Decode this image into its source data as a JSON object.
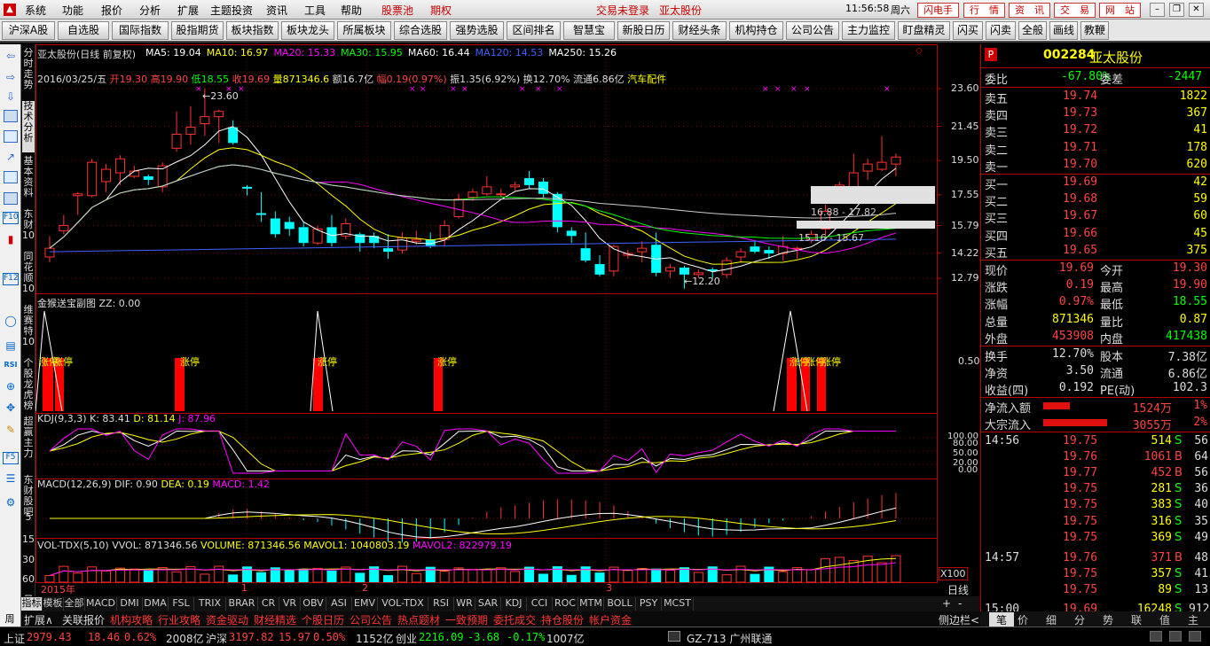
{
  "menu": {
    "items": [
      "系统",
      "功能",
      "报价",
      "分析",
      "扩展",
      "主题投资",
      "资讯",
      "工具",
      "帮助",
      "股票池",
      "期权"
    ],
    "login_status": "交易未登录",
    "stock_name": "亚太股份",
    "clock": "11:56:58",
    "weekday": "周六",
    "right_buttons": [
      "闪电手",
      "行　情",
      "资　讯",
      "交　易",
      "网　站"
    ]
  },
  "toolbar": {
    "buttons": [
      "沪深A股",
      "自选股",
      "国际指数",
      "股指期货",
      "板块指数",
      "板块龙头",
      "所属板块",
      "综合选股",
      "强势选股",
      "区间排名",
      "智慧宝",
      "新股日历",
      "财经头条",
      "机构持仓",
      "公司公告",
      "主力监控",
      "盯盘精灵",
      "闪买",
      "闪卖",
      "全般",
      "画线",
      "教鞭"
    ]
  },
  "left_tabs": [
    {
      "label": "分时走势"
    },
    {
      "label": "技术分析",
      "active": true
    },
    {
      "label": "基本资料"
    },
    {
      "label": "东财10"
    },
    {
      "label": "同花顺10"
    },
    {
      "label": "维赛特10"
    },
    {
      "label": "个股龙虎榜"
    },
    {
      "label": "超赢主力"
    },
    {
      "label": "东财股吧"
    },
    {
      "label": "5"
    },
    {
      "label": "15"
    },
    {
      "label": "30"
    },
    {
      "label": "60"
    },
    {
      "label": "日"
    },
    {
      "label": "周"
    }
  ],
  "main": {
    "title": "亚太股份(日线 前复权)",
    "ma": [
      {
        "label": "MA5: 19.04",
        "color": "#ffffff"
      },
      {
        "label": "MA10: 16.97",
        "color": "#ffff00"
      },
      {
        "label": "MA20: 15.33",
        "color": "#ff00ff"
      },
      {
        "label": "MA30: 15.95",
        "color": "#00ff00"
      },
      {
        "label": "MA60: 16.44",
        "color": "#ffffff"
      },
      {
        "label": "MA120: 14.53",
        "color": "#4060ff"
      },
      {
        "label": "MA250: 15.26",
        "color": "#ffffff"
      }
    ],
    "info": {
      "date": "2016/03/25/五",
      "open": "开19.30",
      "high": "高19.90",
      "low": "低18.55",
      "close": "收19.69",
      "vol": "量871346.6",
      "amount": "额16.7亿",
      "change": "幅0.19(0.97%)",
      "amp": "振1.35(6.92%)",
      "turnover": "换12.70%",
      "float": "流通6.86亿",
      "sector": "汽车配件"
    },
    "yaxis": [
      "23.60",
      "21.45",
      "19.50",
      "17.55",
      "15.79",
      "14.22",
      "12.79"
    ],
    "hi_label": "23.60",
    "lo_label": "12.20",
    "range_upper": "16.88 - 17.82",
    "range_lower": "15.16 - 15.67"
  },
  "sub1": {
    "title": "金猴送宝副图",
    "zz": "ZZ: 0.00",
    "tag": "涨停",
    "yaxis": "0.50"
  },
  "kdj": {
    "title": "KDJ(9,3,3)",
    "k": "K: 83.41",
    "d": "D: 81.14",
    "j": "J: 87.96",
    "yaxis": [
      "100.00",
      "80.00",
      "50.00",
      "20.00",
      "0.00"
    ]
  },
  "macd": {
    "title": "MACD(12,26,9)",
    "dif": "DIF: 0.90",
    "dea": "DEA: 0.19",
    "macd": "MACD: 1.42"
  },
  "vol": {
    "title": "VOL-TDX(5,10)",
    "vvol": "VVOL: 871346.56",
    "volume": "VOLUME: 871346.56",
    "mavol1": "MAVOL1: 1040803.19",
    "mavol2": "MAVOL2: 822979.19",
    "unit": "X100"
  },
  "timeaxis": {
    "labels": [
      "2015年",
      "1",
      "2",
      "3"
    ],
    "period": "日线"
  },
  "bottom_tabs": [
    "指标",
    "模板",
    "全部",
    "MACD",
    "DMI",
    "DMA",
    "FSL",
    "TRIX",
    "BRAR",
    "CR",
    "VR",
    "OBV",
    "ASI",
    "EMV",
    "VOL-TDX",
    "RSI",
    "WR",
    "SAR",
    "KDJ",
    "CCI",
    "ROC",
    "MTM",
    "BOLL",
    "PSY",
    "MCST"
  ],
  "extra_tabs": [
    "扩展∧",
    "关联报价",
    "机构攻略",
    "行业攻略",
    "资金驱动",
    "财经精选",
    "个股日历",
    "公司公告",
    "热点题材",
    "一致预期",
    "委托成交",
    "持仓股份",
    "帐户资金"
  ],
  "quote": {
    "code": "002284",
    "name": "亚太股份",
    "weibi": {
      "label": "委比",
      "value": "-67.80%",
      "label2": "委差",
      "value2": "-2447"
    },
    "asks": [
      {
        "label": "卖五",
        "price": "19.74",
        "vol": "1822"
      },
      {
        "label": "卖四",
        "price": "19.73",
        "vol": "367"
      },
      {
        "label": "卖三",
        "price": "19.72",
        "vol": "41"
      },
      {
        "label": "卖二",
        "price": "19.71",
        "vol": "178"
      },
      {
        "label": "卖一",
        "price": "19.70",
        "vol": "620"
      }
    ],
    "bids": [
      {
        "label": "买一",
        "price": "19.69",
        "vol": "42"
      },
      {
        "label": "买二",
        "price": "19.68",
        "vol": "59"
      },
      {
        "label": "买三",
        "price": "19.67",
        "vol": "60"
      },
      {
        "label": "买四",
        "price": "19.66",
        "vol": "45"
      },
      {
        "label": "买五",
        "price": "19.65",
        "vol": "375"
      }
    ],
    "stats": [
      {
        "l1": "现价",
        "v1": "19.69",
        "c1": "#ff4444",
        "l2": "今开",
        "v2": "19.30",
        "c2": "#ff4444"
      },
      {
        "l1": "涨跌",
        "v1": "0.19",
        "c1": "#ff4444",
        "l2": "最高",
        "v2": "19.90",
        "c2": "#ff4444"
      },
      {
        "l1": "涨幅",
        "v1": "0.97%",
        "c1": "#ff4444",
        "l2": "最低",
        "v2": "18.55",
        "c2": "#00ff00"
      },
      {
        "l1": "总量",
        "v1": "871346",
        "c1": "#ffff00",
        "l2": "量比",
        "v2": "0.87",
        "c2": "#ffff00"
      },
      {
        "l1": "外盘",
        "v1": "453908",
        "c1": "#ff4444",
        "l2": "内盘",
        "v2": "417438",
        "c2": "#00ff00"
      }
    ],
    "stats2": [
      {
        "l1": "换手",
        "v1": "12.70%",
        "l2": "股本",
        "v2": "7.38亿"
      },
      {
        "l1": "净资",
        "v1": "3.50",
        "l2": "流通",
        "v2": "6.86亿"
      },
      {
        "l1": "收益(四)",
        "v1": "0.192",
        "l2": "PE(动)",
        "v2": "102.3"
      }
    ],
    "flow": [
      {
        "label": "净流入额",
        "value": "1524万",
        "pct": "1%",
        "frac": 0.01
      },
      {
        "label": "大宗流入",
        "value": "3055万",
        "pct": "2%",
        "frac": 0.02
      }
    ],
    "ticks": [
      {
        "time": "14:56",
        "price": "19.75",
        "vol": "514",
        "bs": "S",
        "n": "56"
      },
      {
        "time": "",
        "price": "19.76",
        "vol": "1061",
        "bs": "B",
        "n": "64"
      },
      {
        "time": "",
        "price": "19.77",
        "vol": "452",
        "bs": "B",
        "n": "56"
      },
      {
        "time": "",
        "price": "19.75",
        "vol": "281",
        "bs": "S",
        "n": "36"
      },
      {
        "time": "",
        "price": "19.75",
        "vol": "383",
        "bs": "S",
        "n": "40"
      },
      {
        "time": "",
        "price": "19.75",
        "vol": "316",
        "bs": "S",
        "n": "35"
      },
      {
        "time": "",
        "price": "19.75",
        "vol": "369",
        "bs": "S",
        "n": "49"
      },
      {
        "time": "14:57",
        "price": "19.76",
        "vol": "371",
        "bs": "B",
        "n": "48"
      },
      {
        "time": "",
        "price": "19.75",
        "vol": "357",
        "bs": "S",
        "n": "41"
      },
      {
        "time": "",
        "price": "19.75",
        "vol": "89",
        "bs": "S",
        "n": "13"
      },
      {
        "time": "15:00",
        "price": "19.69",
        "vol": "16248",
        "bs": "S",
        "n": "912"
      }
    ],
    "tabs": [
      "笔",
      "价",
      "细",
      "分",
      "势",
      "联",
      "值",
      "主"
    ],
    "side_label": "侧边栏<"
  },
  "status": {
    "sh_label": "上证",
    "sh_val": "2979.43",
    "sh_chg": "18.46",
    "sh_pct": "0.62%",
    "sh_amt": "2008亿",
    "hs_label": "沪深",
    "hs_val": "3197.82",
    "hs_chg": "15.97",
    "hs_pct": "0.50%",
    "hs_amt": "1152亿",
    "cy_label": "创业",
    "cy_val": "2216.09",
    "cy_chg": "-3.68",
    "cy_pct": "-0.17%",
    "cy_amt": "1007亿",
    "server": "GZ-713 广州联通"
  },
  "chart_data": [
    {
      "type": "candlestick",
      "title": "亚太股份(日线 前复权)",
      "ylim": [
        12,
        24
      ],
      "yticks": [
        23.6,
        21.45,
        19.5,
        17.55,
        15.79,
        14.22,
        12.79
      ],
      "x_labels": [
        "2015年",
        "1",
        "2",
        "3"
      ],
      "candles": [
        [
          14,
          14.5,
          13.7,
          15.2
        ],
        [
          15.5,
          15.8,
          15.3,
          16.4
        ],
        [
          17.5,
          17.6,
          16.4,
          17.7
        ],
        [
          17.5,
          19.4,
          17.4,
          19.6
        ],
        [
          18.3,
          19.0,
          17.7,
          19.3
        ],
        [
          18.8,
          19.6,
          18.1,
          19.8
        ],
        [
          18.6,
          18.9,
          18.5,
          19.2
        ],
        [
          18.6,
          18.4,
          18.1,
          18.7
        ],
        [
          18.0,
          19.2,
          17.7,
          19.4
        ],
        [
          20.2,
          21.0,
          20.0,
          22.3
        ],
        [
          21.0,
          21.4,
          20.4,
          22.6
        ],
        [
          21.6,
          22.0,
          20.9,
          23.6
        ],
        [
          22.0,
          22.3,
          20.5,
          22.4
        ],
        [
          21.4,
          20.5,
          20.4,
          21.8
        ],
        [
          18.0,
          17.9,
          17.5,
          18.1
        ],
        [
          16.5,
          16.4,
          16.0,
          17.7
        ],
        [
          16.2,
          15.3,
          15.1,
          16.6
        ],
        [
          16.0,
          15.6,
          15.2,
          16.3
        ],
        [
          15.7,
          14.8,
          14.6,
          16.0
        ],
        [
          14.8,
          15.6,
          14.7,
          15.8
        ],
        [
          15.7,
          14.8,
          14.6,
          16.4
        ],
        [
          15.2,
          15.9,
          15.0,
          16.2
        ],
        [
          15.3,
          14.8,
          14.3,
          15.4
        ],
        [
          15.2,
          14.8,
          14.5,
          15.4
        ],
        [
          14.5,
          14.3,
          13.9,
          15.3
        ],
        [
          14.4,
          15.1,
          14.2,
          15.4
        ],
        [
          14.9,
          15.0,
          14.7,
          15.5
        ],
        [
          15.0,
          14.6,
          14.5,
          15.4
        ],
        [
          15.0,
          15.8,
          14.6,
          16.1
        ],
        [
          16.3,
          17.3,
          16.2,
          17.6
        ],
        [
          17.4,
          17.7,
          17.2,
          17.9
        ],
        [
          17.6,
          18.0,
          17.5,
          18.6
        ],
        [
          17.6,
          17.6,
          17.4,
          17.9
        ],
        [
          18.0,
          18.1,
          17.8,
          18.3
        ],
        [
          18.5,
          18.1,
          17.9,
          18.9
        ],
        [
          18.3,
          17.6,
          17.4,
          18.5
        ],
        [
          17.6,
          15.7,
          15.4,
          17.7
        ],
        [
          15.5,
          15.2,
          14.8,
          15.7
        ],
        [
          14.5,
          13.8,
          13.7,
          15.4
        ],
        [
          13.6,
          13.0,
          12.9,
          14.1
        ],
        [
          13.2,
          14.6,
          12.9,
          14.7
        ],
        [
          14.1,
          14.2,
          13.9,
          14.4
        ],
        [
          14.3,
          14.5,
          13.7,
          14.9
        ],
        [
          14.7,
          13.1,
          12.9,
          15.4
        ],
        [
          13.2,
          13.4,
          12.8,
          13.6
        ],
        [
          13.4,
          13.0,
          12.2,
          13.5
        ],
        [
          13.0,
          13.1,
          12.8,
          13.3
        ],
        [
          13.3,
          13.2,
          12.8,
          13.4
        ],
        [
          13.0,
          13.8,
          12.8,
          14.0
        ],
        [
          14.0,
          14.3,
          13.7,
          14.5
        ],
        [
          14.6,
          14.3,
          14.2,
          14.9
        ],
        [
          14.4,
          14.2,
          13.9,
          14.6
        ],
        [
          14.2,
          14.6,
          13.8,
          15.2
        ],
        [
          14.5,
          14.5,
          13.9,
          14.6
        ],
        [
          15.0,
          15.3,
          14.8,
          15.5
        ],
        [
          15.6,
          16.6,
          15.1,
          17.0
        ],
        [
          17.5,
          18.1,
          17.3,
          18.3
        ],
        [
          17.9,
          18.8,
          17.1,
          19.9
        ],
        [
          18.9,
          19.3,
          18.4,
          19.6
        ],
        [
          19.0,
          19.4,
          18.9,
          20.9
        ],
        [
          19.3,
          19.7,
          18.6,
          19.9
        ]
      ],
      "ma_visible": [
        "MA5",
        "MA10",
        "MA20",
        "MA30",
        "MA60",
        "MA120"
      ]
    },
    {
      "type": "bar",
      "title": "金猴送宝副图",
      "series": [
        {
          "name": "涨停",
          "indices": [
            1,
            2,
            9,
            28,
            55,
            56,
            57
          ]
        }
      ],
      "yticks": [
        0.5
      ]
    },
    {
      "type": "line",
      "title": "KDJ(9,3,3)",
      "series": [
        {
          "name": "K",
          "last": 83.41
        },
        {
          "name": "D",
          "last": 81.14
        },
        {
          "name": "J",
          "last": 87.96
        }
      ],
      "ylim": [
        0,
        100
      ]
    },
    {
      "type": "bar",
      "title": "MACD(12,26,9)",
      "series": [
        {
          "name": "DIF",
          "last": 0.9
        },
        {
          "name": "DEA",
          "last": 0.19
        },
        {
          "name": "MACD",
          "last": 1.42
        }
      ]
    },
    {
      "type": "bar",
      "title": "VOL-TDX(5,10)",
      "series": [
        {
          "name": "VOLUME",
          "last": 871346.56
        },
        {
          "name": "MAVOL1",
          "last": 1040803.19
        },
        {
          "name": "MAVOL2",
          "last": 822979.19
        }
      ]
    }
  ]
}
